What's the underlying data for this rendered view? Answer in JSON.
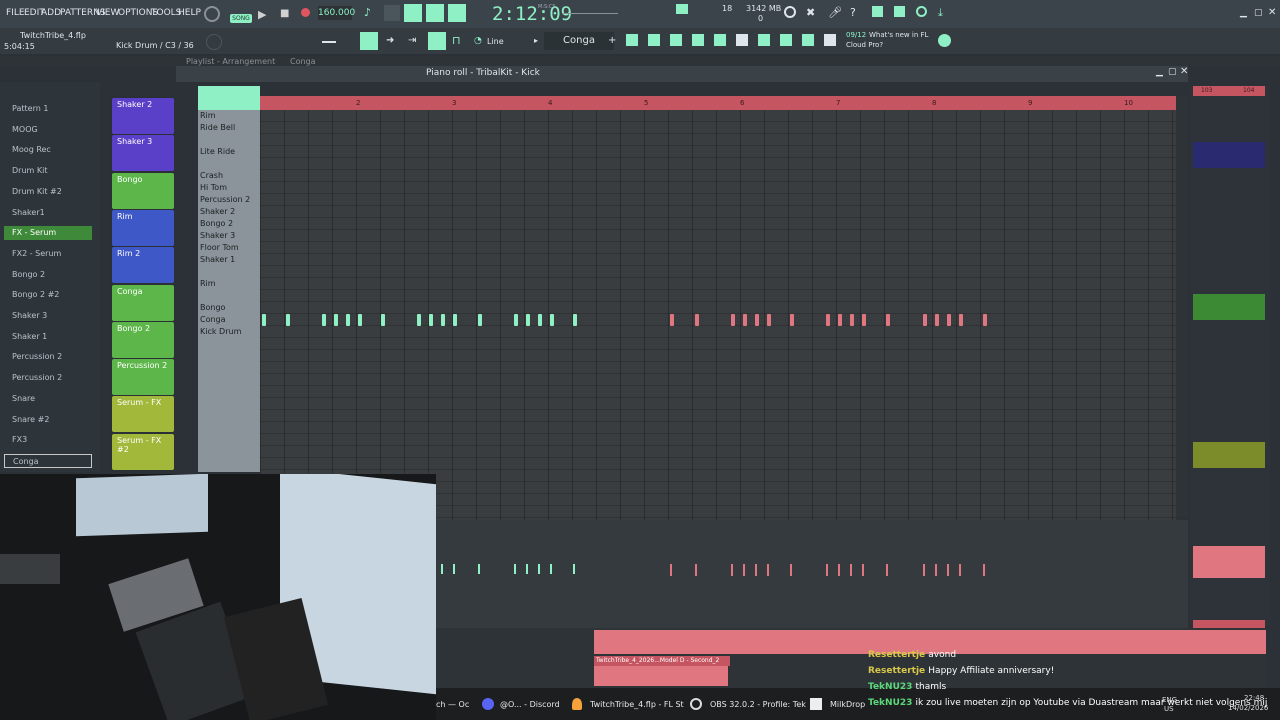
{
  "menu": [
    "FILE",
    "EDIT",
    "ADD",
    "PATTERNS",
    "VIEW",
    "OPTIONS",
    "TOOLS",
    "HELP"
  ],
  "transport": {
    "song_label": "SONG",
    "tempo": "160.000",
    "time": "2:12:09",
    "time_sub": "M:S:CS",
    "cpu": "18",
    "mem": "3142 MB",
    "mem_sub": "0"
  },
  "info": {
    "project": "TwitchTribe_4.flp",
    "elapsed": "5:04:15",
    "hint": "Kick Drum / C3 / 36",
    "snap_mode": "Line",
    "channel_name": "Conga",
    "news_date": "09/12",
    "news_text1": "What's new in FL",
    "news_text2": "Cloud Pro?"
  },
  "playlist_title": "Playlist - Arrangement",
  "playlist_sub": "Conga",
  "pianoroll_title": "Piano roll - TribalKit - Kick",
  "browser_items": [
    "Pattern 1",
    "MOOG",
    "Moog Rec",
    "Drum Kit",
    "Drum Kit #2",
    "Shaker1",
    "FX - Serum",
    "FX2 - Serum",
    "Bongo 2",
    "Bongo 2 #2",
    "Shaker 3",
    "Shaker 1",
    "Percussion 2",
    "Percussion 2",
    "Snare",
    "Snare #2",
    "FX3",
    "Conga"
  ],
  "channels": [
    {
      "name": "Shaker 2",
      "color": "#5a3fc8"
    },
    {
      "name": "Shaker 3",
      "color": "#5a3fc8"
    },
    {
      "name": "Bongo",
      "color": "#5db64a"
    },
    {
      "name": "Rim",
      "color": "#3f58c8"
    },
    {
      "name": "Rim 2",
      "color": "#3f58c8"
    },
    {
      "name": "Conga",
      "color": "#5db64a"
    },
    {
      "name": "Bongo 2",
      "color": "#5db64a"
    },
    {
      "name": "Percussion 2",
      "color": "#5db64a"
    },
    {
      "name": "Serum - FX",
      "color": "#a2b83a"
    },
    {
      "name": "Serum - FX #2",
      "color": "#a2b83a"
    }
  ],
  "key_labels": [
    {
      "label": "Rim",
      "row": 0
    },
    {
      "label": "Ride Bell",
      "row": 1
    },
    {
      "label": "Lite Ride",
      "row": 3
    },
    {
      "label": "Crash",
      "row": 5
    },
    {
      "label": "Hi Tom",
      "row": 6
    },
    {
      "label": "Percussion 2",
      "row": 7
    },
    {
      "label": "Shaker 2",
      "row": 8
    },
    {
      "label": "Bongo 2",
      "row": 9
    },
    {
      "label": "Shaker 3",
      "row": 10
    },
    {
      "label": "Floor Tom",
      "row": 11
    },
    {
      "label": "Shaker 1",
      "row": 12
    },
    {
      "label": "Rim",
      "row": 14
    },
    {
      "label": "Bongo",
      "row": 16
    },
    {
      "label": "Conga",
      "row": 17
    },
    {
      "label": "Kick Drum",
      "row": 18
    }
  ],
  "ruler": [
    "2",
    "3",
    "4",
    "5",
    "6",
    "7",
    "8",
    "9",
    "10"
  ],
  "playlist_ruler": [
    "103",
    "104"
  ],
  "notes_green": [
    262,
    286,
    322,
    334,
    346,
    358,
    381,
    417,
    429,
    441,
    453,
    478,
    514,
    526,
    538,
    550,
    573
  ],
  "notes_red": [
    670,
    695,
    731,
    743,
    755,
    767,
    790,
    826,
    838,
    850,
    862,
    886,
    923,
    935,
    947,
    959,
    983
  ],
  "clip_name": "TwitchTribe_4_2026...Model D - Second_2",
  "chat": [
    {
      "user": "Resettertje",
      "text": "avond",
      "color": "#d8c84a"
    },
    {
      "user": "Resettertje",
      "text": "Happy Affiliate anniversary!",
      "color": "#d8c84a"
    },
    {
      "user": "TekNU23",
      "text": "thamls",
      "color": "#5ad87a"
    },
    {
      "user": "TekNU23",
      "text": "ik zou live moeten zijn op Youtube via Duastream maar werkt niet volgens mij",
      "color": "#5ad87a"
    }
  ],
  "taskbar": [
    "ch — Oc",
    "@O... - Discord",
    "TwitchTribe_4.flp - FL St",
    "OBS 32.0.2 - Profile: Tek",
    "MilkDrop"
  ],
  "tray": {
    "lang": "ENG",
    "region": "US",
    "time": "22:48",
    "date": "14/02/2026"
  },
  "colors": {
    "accent_green": "#8ef0c4",
    "note_red": "#e0767f",
    "ruler": "#c45561"
  }
}
